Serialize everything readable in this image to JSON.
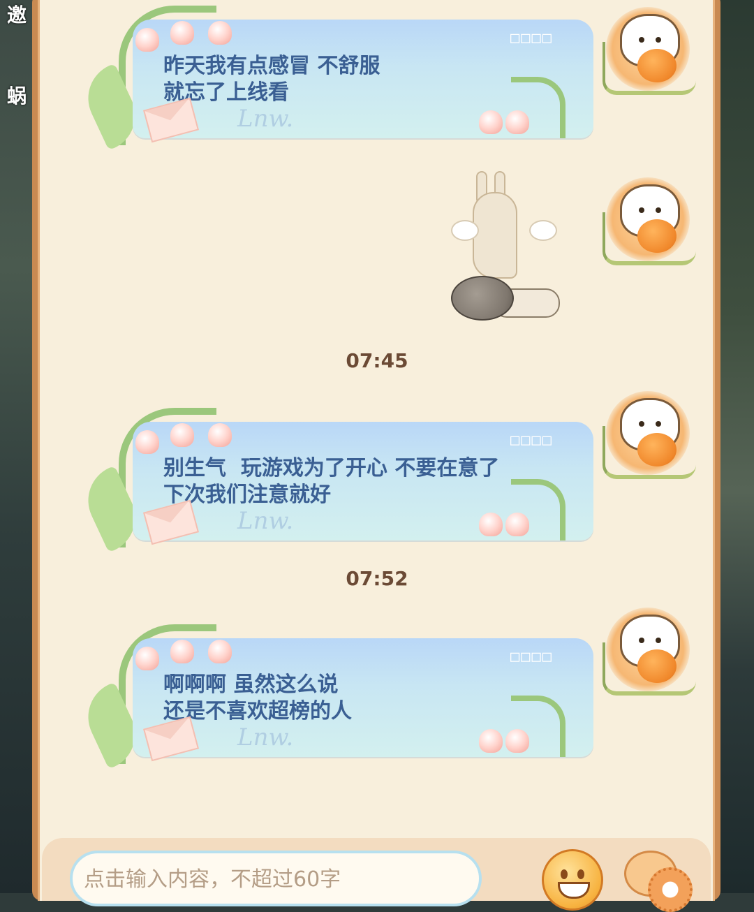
{
  "background": {
    "left_text_top": "邀",
    "left_text_mid": "蜗"
  },
  "messages": [
    {
      "dots": "□□□□",
      "text": "昨天我有点感冒 不舒服\n就忘了上线看",
      "signature": "Lnw."
    },
    {
      "dots": "□□□□",
      "text": "别生气  玩游戏为了开心 不要在意了\n下次我们注意就好",
      "signature": "Lnw."
    },
    {
      "dots": "□□□□",
      "text": "啊啊啊 虽然这么说\n还是不喜欢超榜的人",
      "signature": "Lnw."
    }
  ],
  "timestamps": [
    "07:45",
    "07:52"
  ],
  "input": {
    "placeholder": "点击输入内容，不超过60字"
  },
  "icons": {
    "emoji": "emoji-face-icon",
    "more": "gear-bubble-icon"
  },
  "colors": {
    "panel_bg": "#f8efdc",
    "bubble_text": "#3a5f93",
    "timestamp": "#6b4a35"
  }
}
